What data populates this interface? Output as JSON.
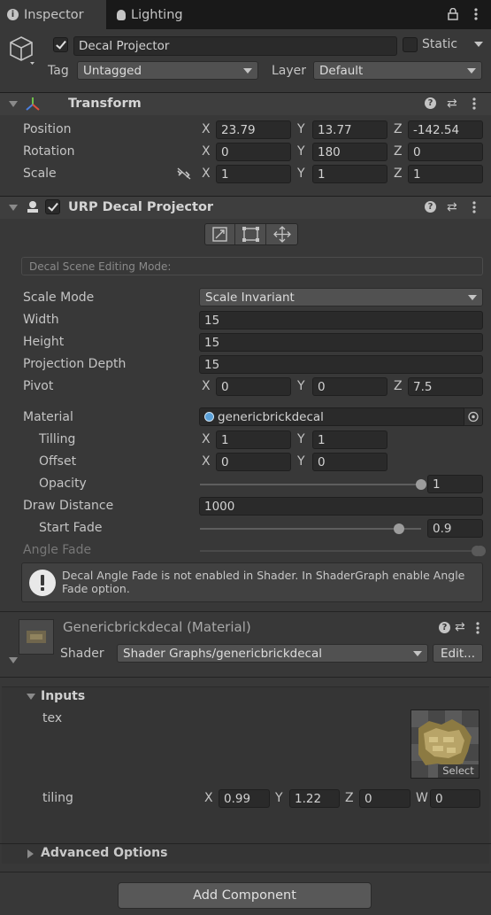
{
  "tabs": [
    {
      "label": "Inspector"
    },
    {
      "label": "Lighting"
    }
  ],
  "object": {
    "name": "Decal Projector",
    "static_label": "Static",
    "tag_label": "Tag",
    "tag_value": "Untagged",
    "layer_label": "Layer",
    "layer_value": "Default"
  },
  "transform": {
    "title": "Transform",
    "position": {
      "label": "Position",
      "x": "23.79",
      "y": "13.77",
      "z": "-142.54"
    },
    "rotation": {
      "label": "Rotation",
      "x": "0",
      "y": "180",
      "z": "0"
    },
    "scale": {
      "label": "Scale",
      "x": "1",
      "y": "1",
      "z": "1"
    }
  },
  "axes": {
    "x": "X",
    "y": "Y",
    "z": "Z",
    "w": "W"
  },
  "decal": {
    "title": "URP Decal Projector",
    "editing_mode": "Decal Scene Editing Mode:",
    "scale_mode": {
      "label": "Scale Mode",
      "value": "Scale Invariant"
    },
    "width": {
      "label": "Width",
      "value": "15"
    },
    "height": {
      "label": "Height",
      "value": "15"
    },
    "projection_depth": {
      "label": "Projection Depth",
      "value": "15"
    },
    "pivot": {
      "label": "Pivot",
      "x": "0",
      "y": "0",
      "z": "7.5"
    },
    "material": {
      "label": "Material",
      "value": "genericbrickdecal"
    },
    "tilling": {
      "label": "Tilling",
      "x": "1",
      "y": "1"
    },
    "offset": {
      "label": "Offset",
      "x": "0",
      "y": "0"
    },
    "opacity": {
      "label": "Opacity",
      "value": "1",
      "fraction": 1.0
    },
    "draw_distance": {
      "label": "Draw Distance",
      "value": "1000"
    },
    "start_fade": {
      "label": "Start Fade",
      "value": "0.9",
      "fraction": 0.9
    },
    "angle_fade": {
      "label": "Angle Fade"
    },
    "warning": "Decal Angle Fade is not enabled in Shader. In ShaderGraph enable Angle Fade option."
  },
  "material_section": {
    "title": "Genericbrickdecal (Material)",
    "shader_label": "Shader",
    "shader_value": "Shader Graphs/genericbrickdecal",
    "edit_label": "Edit...",
    "inputs_label": "Inputs",
    "tex_label": "tex",
    "select_label": "Select",
    "tiling": {
      "label": "tiling",
      "x": "0.99",
      "y": "1.22",
      "z": "0",
      "w": "0"
    },
    "advanced_label": "Advanced Options"
  },
  "add_component": "Add Component",
  "colors": {
    "background": "#383838",
    "field": "#2a2a2a",
    "header": "#3e3e3e"
  }
}
